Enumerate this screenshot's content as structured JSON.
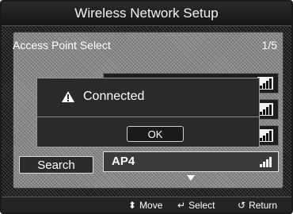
{
  "window": {
    "title": "Wireless Network Setup"
  },
  "section": {
    "label": "Access Point Select",
    "page": "1/5"
  },
  "access_points": [
    {
      "name": "",
      "signal_bars": 4
    },
    {
      "name": "",
      "signal_bars": 4
    },
    {
      "name": "",
      "signal_bars": 4
    },
    {
      "name": "AP4",
      "signal_bars": 4,
      "selected": true
    }
  ],
  "dialog": {
    "icon": "warning-icon",
    "message": "Connected",
    "ok_label": "OK"
  },
  "buttons": {
    "search_label": "Search"
  },
  "footer": {
    "move_label": "Move",
    "select_label": "Select",
    "return_label": "Return"
  },
  "icons": {
    "scroll": "scroll-down-arrow-icon",
    "move": "move-icon",
    "select": "enter-icon",
    "return": "return-icon"
  }
}
